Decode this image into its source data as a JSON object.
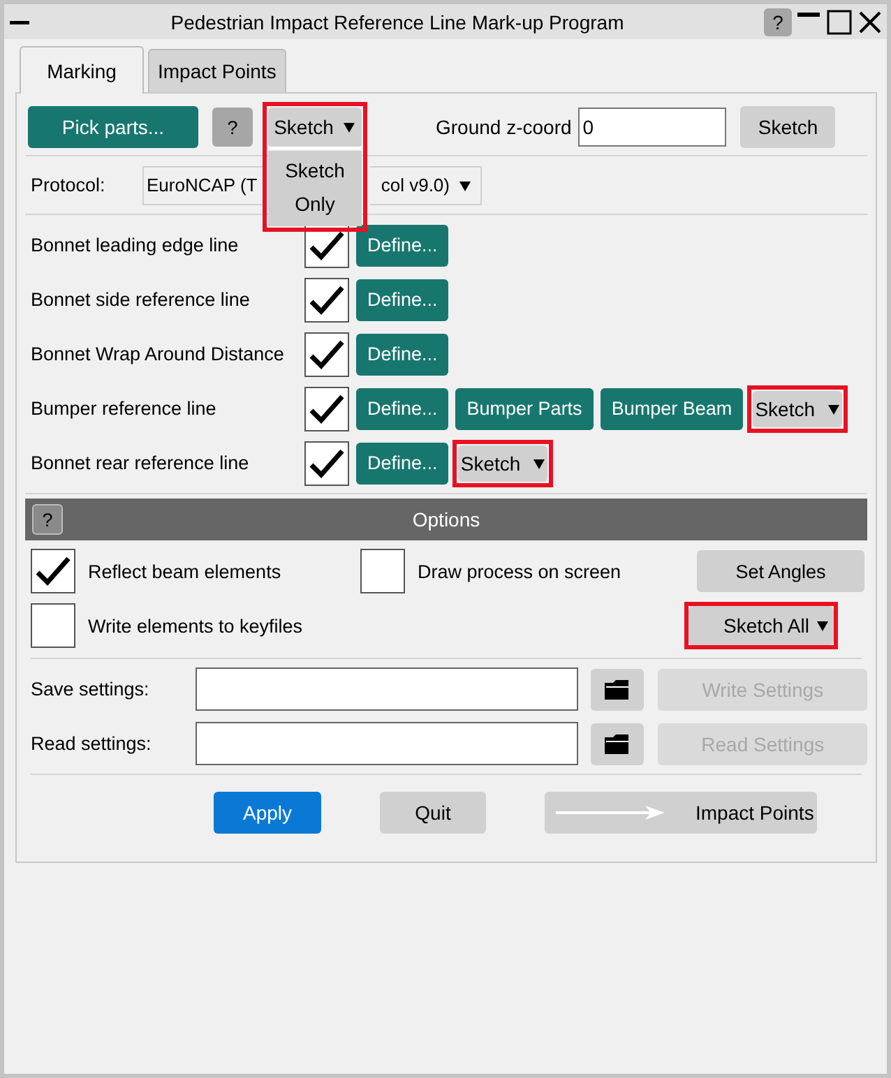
{
  "window": {
    "title": "Pedestrian Impact Reference Line Mark-up Program",
    "help": "?"
  },
  "tabs": [
    {
      "label": "Marking",
      "selected": true
    },
    {
      "label": "Impact Points",
      "selected": false
    }
  ],
  "toolbar": {
    "pick_button": "Pick parts...",
    "help": "?",
    "sketch_dropdown": {
      "value": "Sketch",
      "highlighted": true,
      "expanded": true,
      "options": [
        "Sketch",
        "Only"
      ]
    },
    "ground_label": "Ground z-coord",
    "ground_value": "0",
    "sketch_button": "Sketch"
  },
  "protocol": {
    "label": "Protocol:",
    "value_start": "EuroNCAP (T",
    "value_end": "col v9.0)"
  },
  "lines": [
    {
      "label": "Bonnet leading edge line",
      "checked": true,
      "buttons": [
        {
          "kind": "button",
          "label": "Define..."
        }
      ]
    },
    {
      "label": "Bonnet side reference line",
      "checked": true,
      "buttons": [
        {
          "kind": "button",
          "label": "Define..."
        }
      ]
    },
    {
      "label": "Bonnet Wrap Around Distance",
      "checked": true,
      "buttons": [
        {
          "kind": "button",
          "label": "Define..."
        }
      ]
    },
    {
      "label": "Bumper reference line",
      "checked": true,
      "buttons": [
        {
          "kind": "button",
          "label": "Define..."
        },
        {
          "kind": "button",
          "label": "Bumper Parts"
        },
        {
          "kind": "button",
          "label": "Bumper Beam"
        },
        {
          "kind": "dropdown",
          "label": "Sketch",
          "highlighted": true
        }
      ]
    },
    {
      "label": "Bonnet rear reference line",
      "checked": true,
      "buttons": [
        {
          "kind": "button",
          "label": "Define..."
        },
        {
          "kind": "dropdown",
          "label": "Sketch",
          "highlighted": true
        }
      ]
    }
  ],
  "options": {
    "help": "?",
    "title": "Options",
    "reflect": {
      "label": "Reflect beam elements",
      "checked": true
    },
    "draw_process": {
      "label": "Draw process on screen",
      "checked": false
    },
    "set_angles": "Set Angles",
    "write_elements": {
      "label": "Write elements to keyfiles",
      "checked": false
    },
    "sketch_all": {
      "label": "Sketch All",
      "highlighted": true
    }
  },
  "settings": [
    {
      "label": "Save settings:",
      "button": "Write Settings",
      "disabled": true
    },
    {
      "label": "Read settings:",
      "button": "Read Settings",
      "disabled": true
    }
  ],
  "footer": {
    "apply": "Apply",
    "quit": "Quit",
    "impact_points": "Impact Points"
  }
}
